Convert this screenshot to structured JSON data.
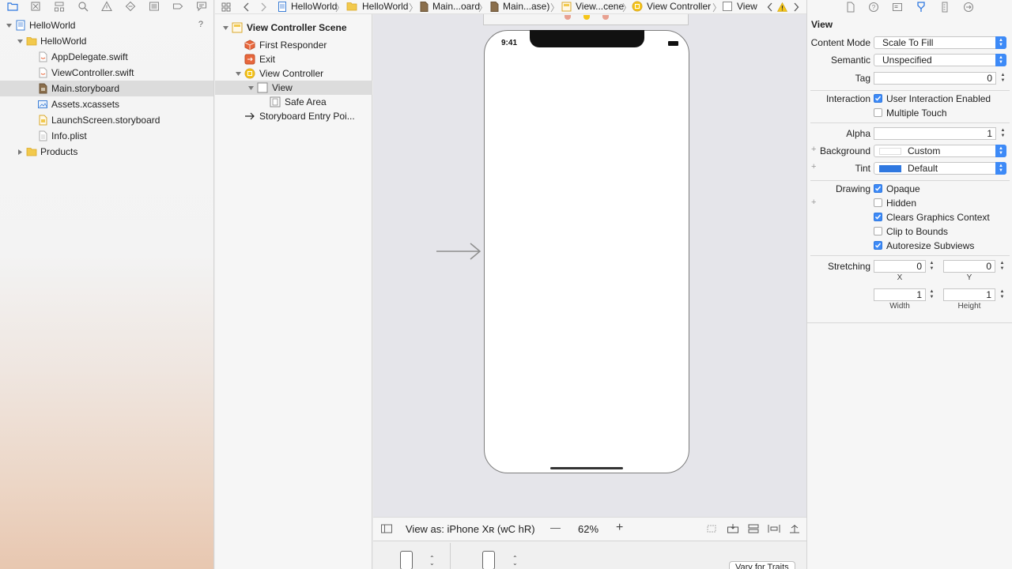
{
  "navigator": {
    "toolbar_icons": [
      "folder-icon",
      "source-control-icon",
      "hierarchy-icon",
      "find-icon",
      "issue-warning-icon",
      "test-diamond-icon",
      "debug-list-icon",
      "breakpoint-tag-icon",
      "report-bubble-icon"
    ],
    "issue_badge": "?",
    "items": [
      {
        "label": "HelloWorld",
        "icon": "project-icon"
      },
      {
        "label": "HelloWorld",
        "icon": "folder-icon"
      },
      {
        "label": "AppDelegate.swift",
        "icon": "swift-file-icon"
      },
      {
        "label": "ViewController.swift",
        "icon": "swift-file-icon"
      },
      {
        "label": "Main.storyboard",
        "icon": "storyboard-file-icon"
      },
      {
        "label": "Assets.xcassets",
        "icon": "asset-catalog-icon"
      },
      {
        "label": "LaunchScreen.storyboard",
        "icon": "storyboard-file-icon"
      },
      {
        "label": "Info.plist",
        "icon": "plist-file-icon"
      },
      {
        "label": "Products",
        "icon": "folder-icon"
      }
    ]
  },
  "jumpbar": {
    "crumbs": [
      "HelloWorld",
      "HelloWorld",
      "Main...oard",
      "Main...ase)",
      "View...cene",
      "View Controller",
      "View"
    ]
  },
  "outline": {
    "items": [
      {
        "label": "View Controller Scene"
      },
      {
        "label": "First Responder"
      },
      {
        "label": "Exit"
      },
      {
        "label": "View Controller"
      },
      {
        "label": "View"
      },
      {
        "label": "Safe Area"
      },
      {
        "label": "Storyboard Entry Poi..."
      }
    ]
  },
  "canvas": {
    "phone_time": "9:41"
  },
  "bottombar": {
    "view_as": "View as: iPhone Xʀ (wC hR)",
    "zoom": "62%",
    "zoom_out": "—",
    "zoom_in": "+",
    "vary_for_traits": "Vary for Traits"
  },
  "inspector": {
    "title": "View",
    "content_mode_label": "Content Mode",
    "content_mode_value": "Scale To Fill",
    "semantic_label": "Semantic",
    "semantic_value": "Unspecified",
    "tag_label": "Tag",
    "tag_value": "0",
    "interaction_label": "Interaction",
    "user_interaction": "User Interaction Enabled",
    "multiple_touch": "Multiple Touch",
    "alpha_label": "Alpha",
    "alpha_value": "1",
    "background_label": "Background",
    "background_value": "Custom",
    "tint_label": "Tint",
    "tint_value": "Default",
    "tint_color": "#2f78e0",
    "drawing_label": "Drawing",
    "opaque": "Opaque",
    "hidden": "Hidden",
    "clears_graphics": "Clears Graphics Context",
    "clip_to_bounds": "Clip to Bounds",
    "autoresize": "Autoresize Subviews",
    "stretching_label": "Stretching",
    "stretch_x": "0",
    "stretch_y": "0",
    "stretch_w": "1",
    "stretch_h": "1",
    "x_label": "X",
    "y_label": "Y",
    "width_label": "Width",
    "height_label": "Height"
  }
}
